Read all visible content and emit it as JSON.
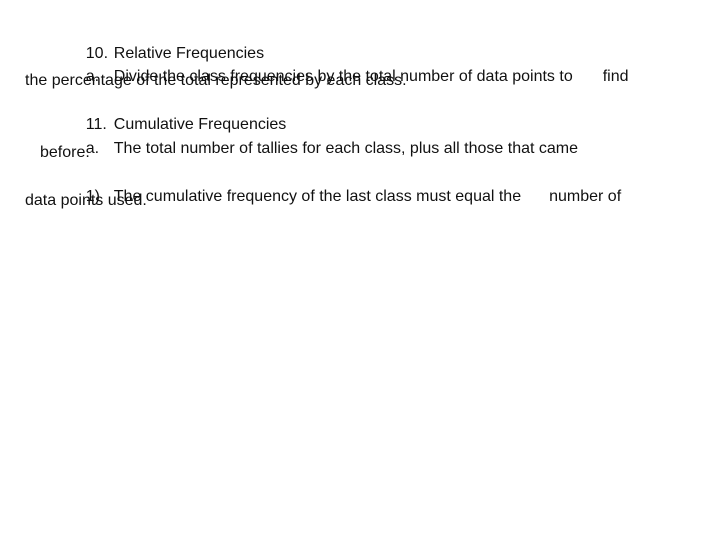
{
  "document": {
    "items": [
      {
        "marker": "10.",
        "text": "Relative Frequencies",
        "sub": {
          "marker": "a.",
          "text_part1": "Divide the class frequencies by the total number of data points to",
          "text_part2": "find",
          "continuation": "the percentage of the total represented by each class."
        }
      },
      {
        "marker": "11.",
        "text": "Cumulative Frequencies",
        "sub": {
          "marker": "a.",
          "text": "The total number of tallies for each class, plus all those that came",
          "continuation": "before.",
          "subsub": {
            "marker": "1)",
            "text_part1": "The cumulative frequency of the last class must equal the",
            "text_part2": "number of",
            "continuation": "data points used."
          }
        }
      }
    ]
  }
}
